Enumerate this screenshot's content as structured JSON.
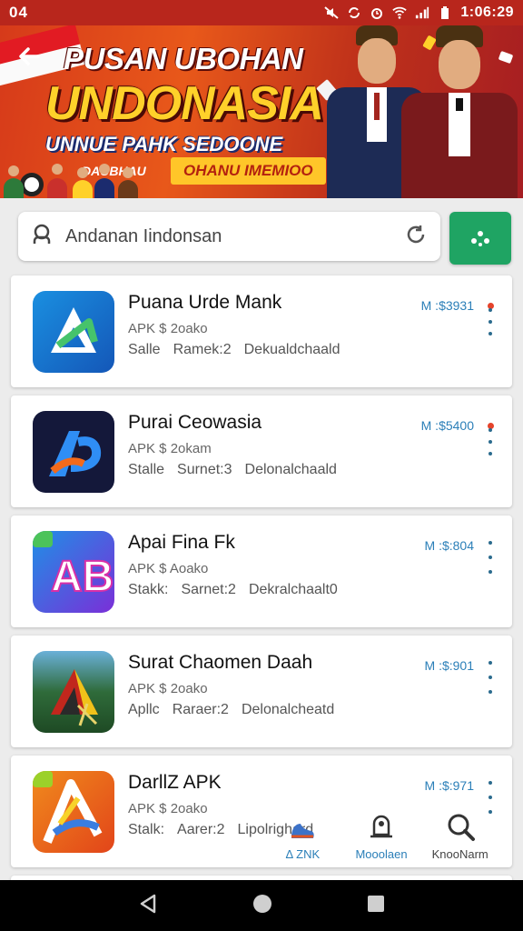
{
  "statusbar": {
    "left_time": "04",
    "clock": "1:06:29"
  },
  "banner": {
    "title": "PUSAN UBOHAN",
    "headline": "UNDONASIA",
    "subtitle": "UNNUE PAHK SEDOONE",
    "chip_left": "DAUBHAU",
    "chip": "OHANU IMEMIOO",
    "colors": {
      "bg": "#d63a1a",
      "headline": "#ffd12a",
      "chip": "#ffc629"
    }
  },
  "search": {
    "placeholder": "Andanan Iindonsan",
    "accent": "#1fa463"
  },
  "apps": [
    {
      "name": "Puana Urde Mank",
      "sub": "APK $ 2oako",
      "meta": [
        "Salle",
        "Ramek:2",
        "Dekualdchaald"
      ],
      "price": "M :$3931",
      "badge": true,
      "icon": "app-a-icon"
    },
    {
      "name": "Purai Ceowasia",
      "sub": "APK $ 2okam",
      "meta": [
        "Stalle",
        "Surnet:3",
        "Delonalchaald"
      ],
      "price": "M :$5400",
      "badge": true,
      "icon": "app-b-icon"
    },
    {
      "name": "Apai Fina Fk",
      "sub": "APK $ Aoako",
      "meta": [
        "Stakk:",
        "Sarnet:2",
        "Dekralchaalt0"
      ],
      "price": "M :$:804",
      "badge": false,
      "icon": "app-ab-icon"
    },
    {
      "name": "Surat Chaomen Daah",
      "sub": "APK $ 2oako",
      "meta": [
        "Apllc",
        "Raraer:2",
        "Delonalcheatd"
      ],
      "price": "M :$:901",
      "badge": false,
      "icon": "app-tent-icon"
    },
    {
      "name": "DarllZ APK",
      "sub": "APK $ 2oako",
      "meta": [
        "Stalk:",
        "Aarer:2",
        "Lipolrighard"
      ],
      "price": "M :$:971",
      "badge": false,
      "icon": "app-arc-icon"
    }
  ],
  "mini_nav": [
    {
      "label": "Δ ZNK",
      "icon": "shoe-icon"
    },
    {
      "label": "Mooolaen",
      "icon": "bell-person-icon"
    },
    {
      "label": "KnooNarm",
      "icon": "search-zoom-icon"
    }
  ]
}
